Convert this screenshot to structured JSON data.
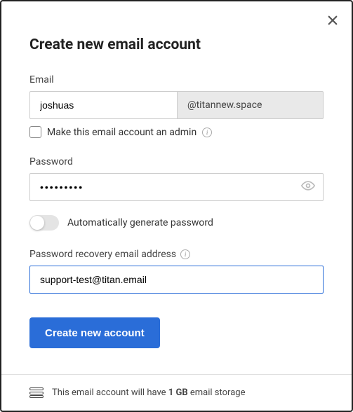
{
  "modal": {
    "title": "Create new email account"
  },
  "email": {
    "label": "Email",
    "value": "joshuas",
    "domain": "@titannew.space"
  },
  "admin": {
    "label": "Make this email account an admin",
    "checked": false
  },
  "password": {
    "label": "Password",
    "value": "•••••••••"
  },
  "autogen": {
    "label": "Automatically generate password",
    "on": false
  },
  "recovery": {
    "label": "Password recovery email address",
    "value": "support-test@titan.email"
  },
  "submit": {
    "label": "Create new account"
  },
  "footer": {
    "prefix": "This email account will have ",
    "amount": "1 GB",
    "suffix": " email storage"
  }
}
